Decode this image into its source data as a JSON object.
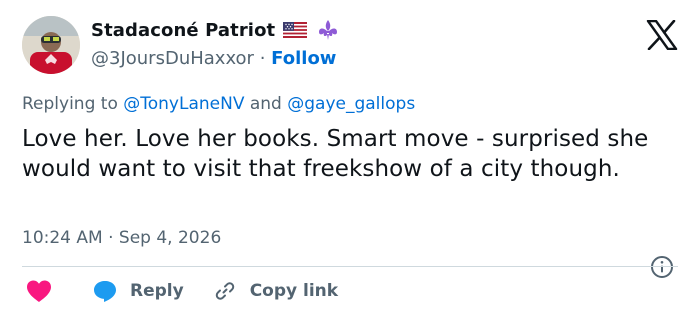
{
  "author": {
    "display_name": "Stadaconé Patriot",
    "handle": "@3JoursDuHaxxor",
    "separator": "·",
    "follow_label": "Follow",
    "badges": [
      "us-flag-icon",
      "fleur-de-lis-icon"
    ]
  },
  "reply_context": {
    "prefix": "Replying to",
    "mention_1": "@TonyLaneNV",
    "conjunction": "and",
    "mention_2": "@gaye_gallops"
  },
  "tweet": {
    "text": "Love her. Love her books. Smart move - surprised she would want to visit that freekshow of a city though.",
    "time": "10:24 AM",
    "separator": "·",
    "date": "Sep 4, 2026"
  },
  "actions": {
    "like_icon": "heart-icon",
    "reply_label": "Reply",
    "copy_label": "Copy link"
  },
  "colors": {
    "text": "#0f1419",
    "secondary": "#536471",
    "link": "#006fd6",
    "like": "#f91880",
    "reply_icon": "#1d9bf0",
    "divider": "#cfd9de"
  }
}
